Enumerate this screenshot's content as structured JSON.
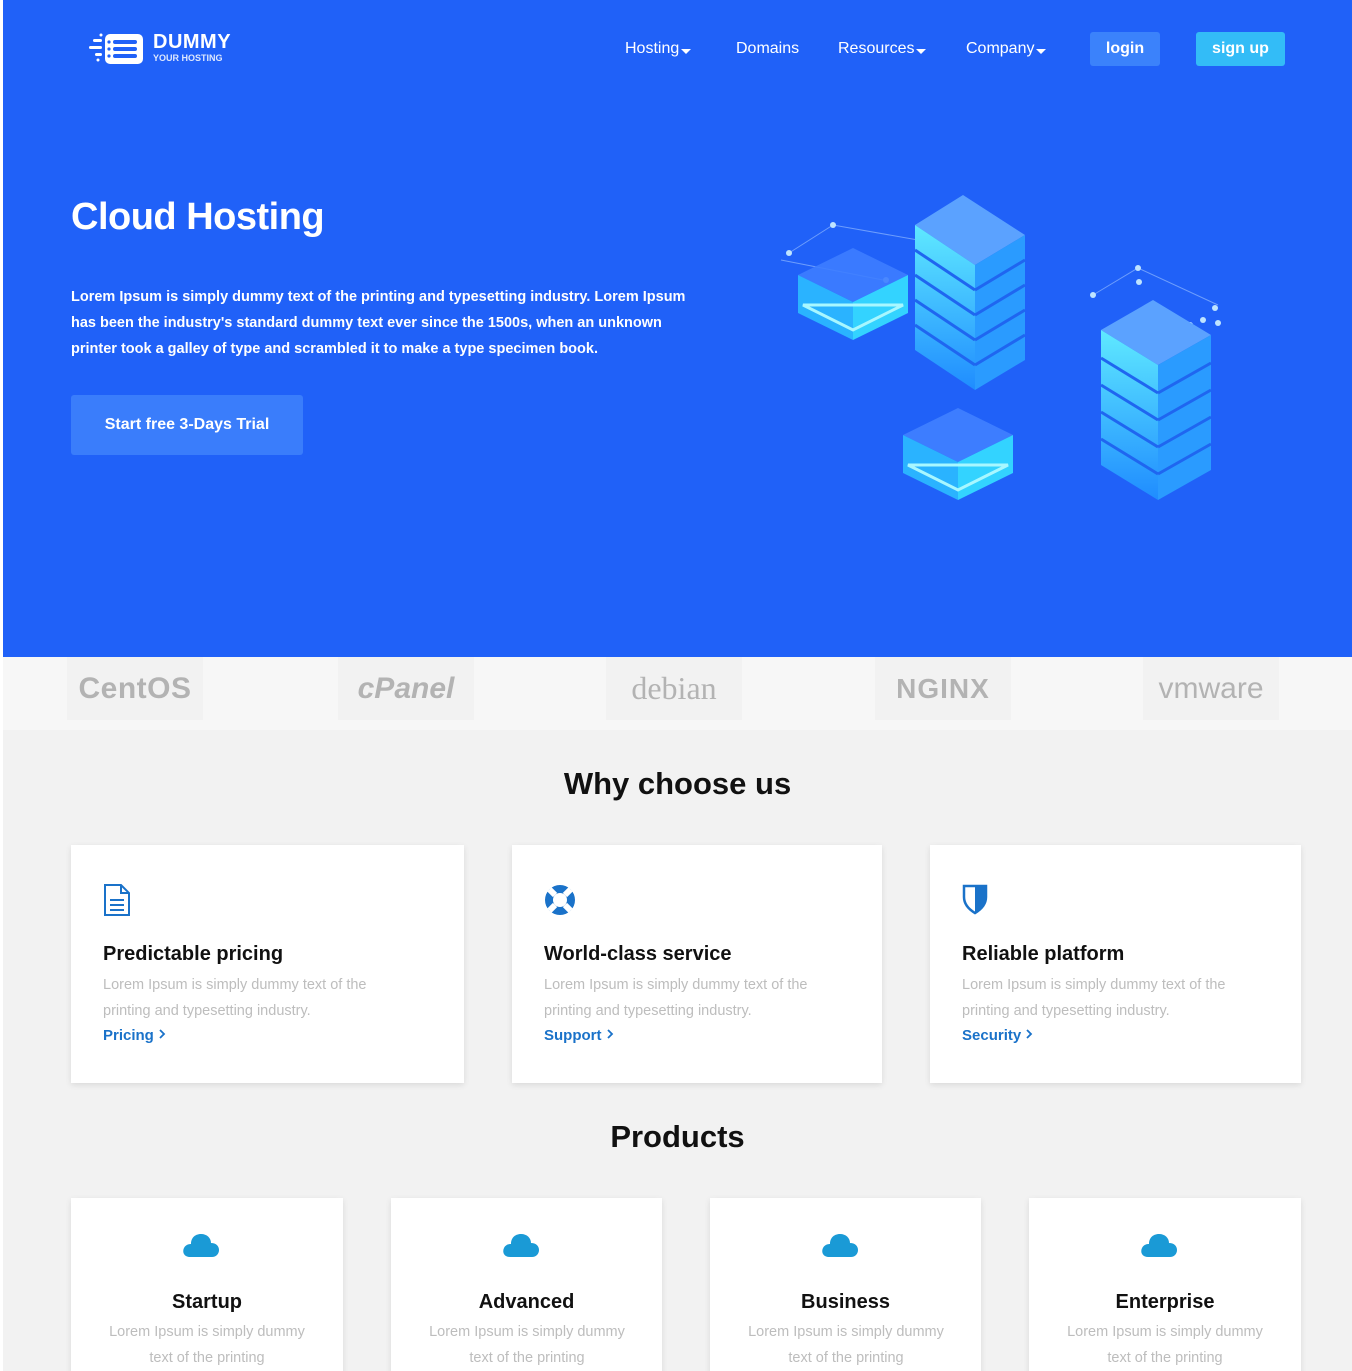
{
  "header": {
    "logo_title": "DUMMY",
    "logo_subtitle": "YOUR HOSTING",
    "nav": [
      {
        "label": "Hosting",
        "dropdown": true
      },
      {
        "label": "Domains",
        "dropdown": false
      },
      {
        "label": "Resources",
        "dropdown": true
      },
      {
        "label": "Company",
        "dropdown": true
      }
    ],
    "login_label": "login",
    "signup_label": "sign up"
  },
  "hero": {
    "title": "Cloud Hosting",
    "text": "Lorem Ipsum is simply dummy text of the printing and typesetting industry. Lorem Ipsum has been the industry's standard dummy text ever since the 1500s, when an unknown printer took a galley of type and scrambled it to make a type specimen book.",
    "cta_label": "Start free 3-Days Trial"
  },
  "brands": [
    "CentOS",
    "cPanel",
    "debian",
    "NGINX",
    "vmware"
  ],
  "why": {
    "title": "Why choose us",
    "cards": [
      {
        "title": "Predictable pricing",
        "text": "Lorem Ipsum is simply dummy text of the printing and typesetting industry.",
        "link": "Pricing",
        "icon": "document-icon"
      },
      {
        "title": "World-class service",
        "text": "Lorem Ipsum is simply dummy text of the printing and typesetting industry.",
        "link": "Support",
        "icon": "lifebuoy-icon"
      },
      {
        "title": "Reliable platform",
        "text": "Lorem Ipsum is simply dummy text of the printing and typesetting industry.",
        "link": "Security",
        "icon": "shield-icon"
      }
    ]
  },
  "products": {
    "title": "Products",
    "cards": [
      {
        "title": "Startup",
        "text": "Lorem Ipsum is simply dummy text of the printing",
        "icon": "cloud-icon"
      },
      {
        "title": "Advanced",
        "text": "Lorem Ipsum is simply dummy text of the printing",
        "icon": "cloud-icon"
      },
      {
        "title": "Business",
        "text": "Lorem Ipsum is simply dummy text of the printing",
        "icon": "cloud-icon"
      },
      {
        "title": "Enterprise",
        "text": "Lorem Ipsum is simply dummy text of the printing",
        "icon": "cloud-icon"
      }
    ]
  },
  "colors": {
    "hero_bg": "#2061f8",
    "login_bg": "#3b82fb",
    "signup_bg": "#33bcf7",
    "link": "#1a72c9",
    "cloud_icon": "#1a9ad6"
  }
}
